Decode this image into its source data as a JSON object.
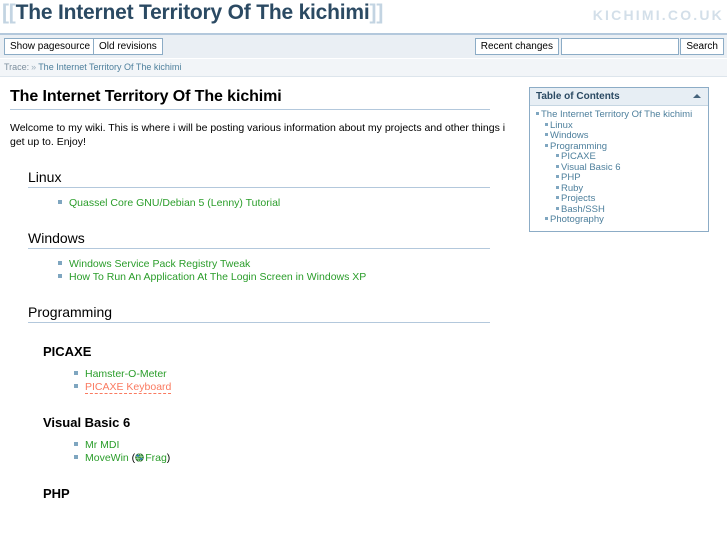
{
  "header": {
    "bracket_open": "[[",
    "site_title": "The Internet Territory Of The kichimi",
    "bracket_close": "]]",
    "logo": "KICHIMI.CO.UK"
  },
  "toolbar": {
    "show_pagesource_label": "Show pagesource",
    "old_revisions_label": "Old revisions",
    "recent_changes_label": "Recent changes",
    "search_button_label": "Search",
    "search_value": "",
    "search_placeholder": ""
  },
  "breadcrumb": {
    "label": "Trace:",
    "separator": "»",
    "current": "The Internet Territory Of The kichimi"
  },
  "toc": {
    "title": "Table of Contents",
    "toggle_icon": "chevron-up-icon",
    "items": [
      {
        "label": "The Internet Territory Of The kichimi",
        "level": 1
      },
      {
        "label": "Linux",
        "level": 2
      },
      {
        "label": "Windows",
        "level": 2
      },
      {
        "label": "Programming",
        "level": 2
      },
      {
        "label": "PICAXE",
        "level": 3
      },
      {
        "label": "Visual Basic 6",
        "level": 3
      },
      {
        "label": "PHP",
        "level": 3
      },
      {
        "label": "Ruby",
        "level": 3
      },
      {
        "label": "Projects",
        "level": 3
      },
      {
        "label": "Bash/SSH",
        "level": 3
      },
      {
        "label": "Photography",
        "level": 2
      }
    ]
  },
  "content": {
    "page_title": "The Internet Territory Of The kichimi",
    "intro": "Welcome to my wiki. This is where i will be posting various information about my projects and other things i get up to. Enjoy!",
    "sections": {
      "linux": {
        "heading": "Linux",
        "links": [
          {
            "label": "Quassel Core GNU/Debian 5 (Lenny) Tutorial",
            "state": "exists"
          }
        ]
      },
      "windows": {
        "heading": "Windows",
        "links": [
          {
            "label": "Windows Service Pack Registry Tweak",
            "state": "exists"
          },
          {
            "label": "How To Run An Application At The Login Screen in Windows XP",
            "state": "exists"
          }
        ]
      },
      "programming": {
        "heading": "Programming"
      },
      "picaxe": {
        "heading": "PICAXE",
        "links": [
          {
            "label": "Hamster-O-Meter",
            "state": "exists"
          },
          {
            "label": "PICAXE Keyboard",
            "state": "missing"
          }
        ]
      },
      "visualbasic6": {
        "heading": "Visual Basic 6",
        "links": [
          {
            "label": "Mr MDI",
            "state": "exists"
          }
        ],
        "movewin_label": "MoveWin",
        "movewin_paren_open": " (",
        "movewin_ext_label": "Frag",
        "movewin_paren_close": ")",
        "movewin_ext_icon": "globe-external-link-icon"
      },
      "php": {
        "heading": "PHP"
      }
    }
  },
  "colors": {
    "link_exists": "#2a9d2a",
    "link_missing": "#fa7a60",
    "accent_border": "#b3c8dc",
    "title_text": "#2b4a63",
    "toolbar_bg": "#eaeff4",
    "bullet": "#7fa6c0"
  }
}
